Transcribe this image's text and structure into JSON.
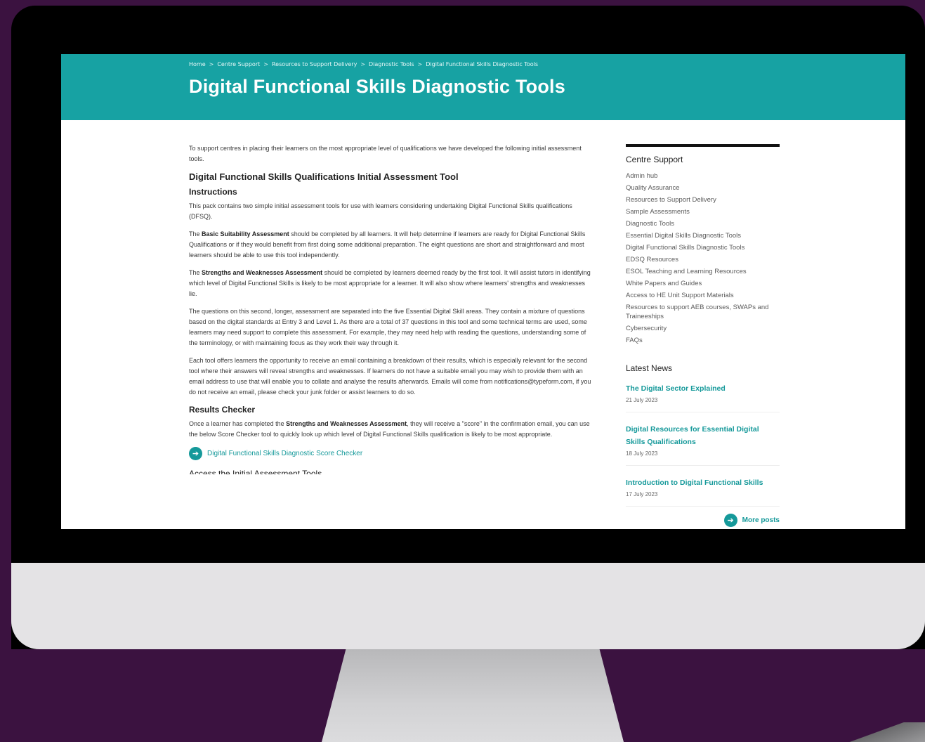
{
  "breadcrumb": [
    "Home",
    "Centre Support",
    "Resources to Support Delivery",
    "Diagnostic Tools",
    "Digital Functional Skills Diagnostic Tools"
  ],
  "breadcrumb_separator": ">",
  "page_title": "Digital Functional Skills Diagnostic Tools",
  "main": {
    "intro": "To support centres in placing their learners on the most appropriate level of qualifications we have developed the following initial assessment tools.",
    "section_title": "Digital Functional Skills Qualifications Initial Assessment Tool",
    "instructions_title": "Instructions",
    "p1": "This pack contains two simple initial assessment tools for use with learners considering undertaking Digital Functional Skills qualifications (DFSQ).",
    "p2_pre": "The ",
    "p2_bold": "Basic Suitability Assessment",
    "p2_post": " should be completed by all learners. It will help determine if learners are ready for Digital Functional Skills Qualifications or if they would benefit from first doing some additional preparation. The eight questions are short and straightforward and most learners should be able to use this tool independently.",
    "p3_pre": "The ",
    "p3_bold": "Strengths and Weaknesses Assessment",
    "p3_post": " should be completed by learners deemed ready by the first tool. It will assist tutors in identifying which level of Digital Functional Skills is likely to be most appropriate for a learner. It will also show where learners' strengths and weaknesses lie.",
    "p4": "The questions on this second, longer, assessment are separated into the five Essential Digital Skill areas. They contain a mixture of questions based on the digital standards at Entry 3 and Level 1. As there are a total of 37 questions in this tool and some technical terms are used, some learners may need support to complete this assessment. For example, they may need help with reading the questions, understanding some of the terminology, or with maintaining focus as they work their way through it.",
    "p5": "Each tool offers learners the opportunity to receive an email containing a breakdown of their results, which is especially relevant for the second tool where their answers will reveal strengths and weaknesses. If learners do not have a suitable email you may wish to provide them with an email address to use that will enable you to collate and analyse the results afterwards. Emails will come from notifications@typeform.com, if you do not receive an email, please check your junk folder or assist learners to do so.",
    "results_title": "Results Checker",
    "p6_pre": "Once a learner has completed the ",
    "p6_bold": "Strengths and Weaknesses Assessment",
    "p6_post": ", they will receive a \"score\" in the confirmation email, you can use the below Score Checker tool to quickly look up which level of Digital Functional Skills qualification is likely to be most appropriate.",
    "cta_label": "Digital Functional Skills Diagnostic Score Checker",
    "cutoff_heading": "Access the Initial Assessment Tools"
  },
  "sidebar": {
    "title": "Centre Support",
    "items": [
      "Admin hub",
      "Quality Assurance",
      "Resources to Support Delivery",
      "Sample Assessments",
      "Diagnostic Tools",
      "Essential Digital Skills Diagnostic Tools",
      "Digital Functional Skills Diagnostic Tools",
      "EDSQ Resources",
      "ESOL Teaching and Learning Resources",
      "White Papers and Guides",
      "Access to HE Unit Support Materials",
      "Resources to support AEB courses, SWAPs and Traineeships",
      "Cybersecurity",
      "FAQs"
    ],
    "news_title": "Latest News",
    "news": [
      {
        "title": "The Digital Sector Explained",
        "date": "21 July 2023"
      },
      {
        "title": "Digital Resources for Essential Digital Skills Qualifications",
        "date": "18 July 2023"
      },
      {
        "title": "Introduction to Digital Functional Skills",
        "date": "17 July 2023"
      }
    ],
    "more_label": "More posts"
  },
  "colors": {
    "brand_teal": "#17a2a3",
    "link_teal": "#15999a",
    "background_purple": "#3b1240"
  },
  "icons": {
    "cta": "arrow-right-circle-icon",
    "more": "arrow-right-circle-icon"
  }
}
